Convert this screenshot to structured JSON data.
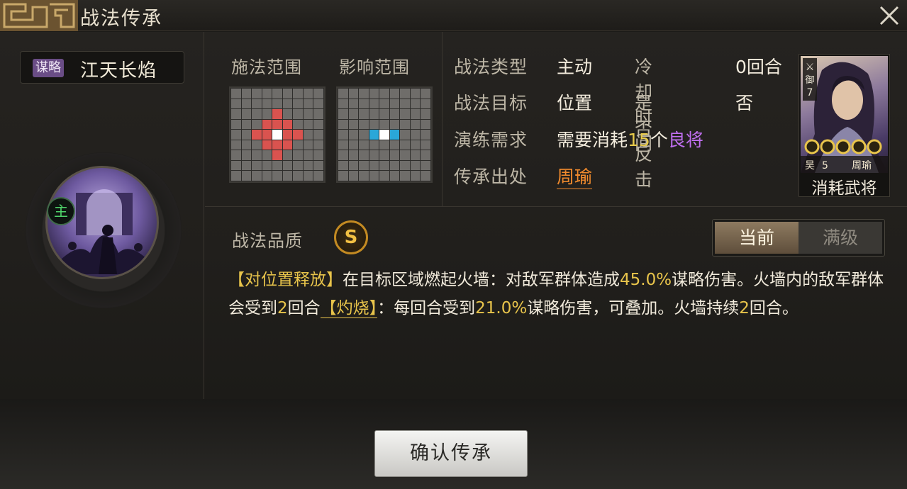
{
  "window": {
    "title": "战法传承",
    "close_label": "×"
  },
  "skill": {
    "type_tag": "谋略",
    "name": "江天长焰",
    "main_badge": "主"
  },
  "ranges": {
    "cast_label": "施法范围",
    "effect_label": "影响范围",
    "cast_grid": {
      "size": 9,
      "red_cells": [
        [
          2,
          4
        ],
        [
          3,
          3
        ],
        [
          3,
          4
        ],
        [
          3,
          5
        ],
        [
          4,
          2
        ],
        [
          4,
          3
        ],
        [
          4,
          5
        ],
        [
          4,
          6
        ],
        [
          5,
          3
        ],
        [
          5,
          4
        ],
        [
          5,
          5
        ],
        [
          6,
          4
        ]
      ],
      "white_cells": [
        [
          4,
          4
        ]
      ]
    },
    "effect_grid": {
      "size": 9,
      "blue_cells": [
        [
          4,
          3
        ],
        [
          4,
          5
        ]
      ],
      "white_cells": [
        [
          4,
          4
        ]
      ]
    }
  },
  "info": {
    "type_label": "战法类型",
    "type_value": "主动",
    "cooldown_label": "冷却时间",
    "cooldown_value": "0回合",
    "target_label": "战法目标",
    "target_value": "位置",
    "counter_label": "是否反击",
    "counter_value": "否",
    "require_label": "演练需求",
    "require_prefix": "需要消耗",
    "require_count": "15",
    "require_unit": "个",
    "require_item": "良将",
    "origin_label": "传承出处",
    "origin_value": "周瑜"
  },
  "general_card": {
    "troop_icons": "⚔",
    "troop_text": "御",
    "cost": "7",
    "stars": 5,
    "faction": "吴",
    "level": "5",
    "name": "周瑜",
    "caption": "消耗武将"
  },
  "quality": {
    "label": "战法品质",
    "grade": "S"
  },
  "toggle": {
    "current": "当前",
    "max": "满级"
  },
  "description": {
    "p1": "【对位置释放】",
    "p2": "在目标区域燃起火墙：对敌军群体造成",
    "p3": "45.0%",
    "p4": "谋略伤害。火墙内的敌军群体会受到",
    "p5": "2",
    "p6": "回合",
    "p7": "【灼烧】",
    "p8": "：每回合受到",
    "p9": "21.0%",
    "p10": "谋略伤害，可叠加。火墙持续",
    "p11": "2",
    "p12": "回合。"
  },
  "actions": {
    "confirm": "确认传承"
  },
  "colors": {
    "red_cell": "#d9534f",
    "blue_cell": "#2aa7d8",
    "gold_text": "#e6c94a",
    "purple_text": "#c06ff0",
    "orange_link": "#f08a2d"
  }
}
